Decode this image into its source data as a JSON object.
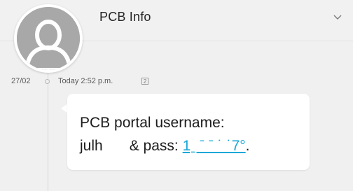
{
  "header": {
    "title": "PCB Info"
  },
  "message": {
    "date": "27/02",
    "time": "Today 2:52 p.m.",
    "sim_slot": "2",
    "line1": "PCB portal username:",
    "username": "julh",
    "pass_label": "& pass:",
    "pass_value": "1ˍ ˉ ˉ ˙ ˙7°",
    "trailing": "."
  },
  "icons": {
    "chevron": "chevron-down-icon",
    "avatar": "avatar-placeholder-icon"
  },
  "colors": {
    "link": "#17a8d8",
    "background": "#f0f0f0",
    "avatar": "#a8a8a8"
  }
}
